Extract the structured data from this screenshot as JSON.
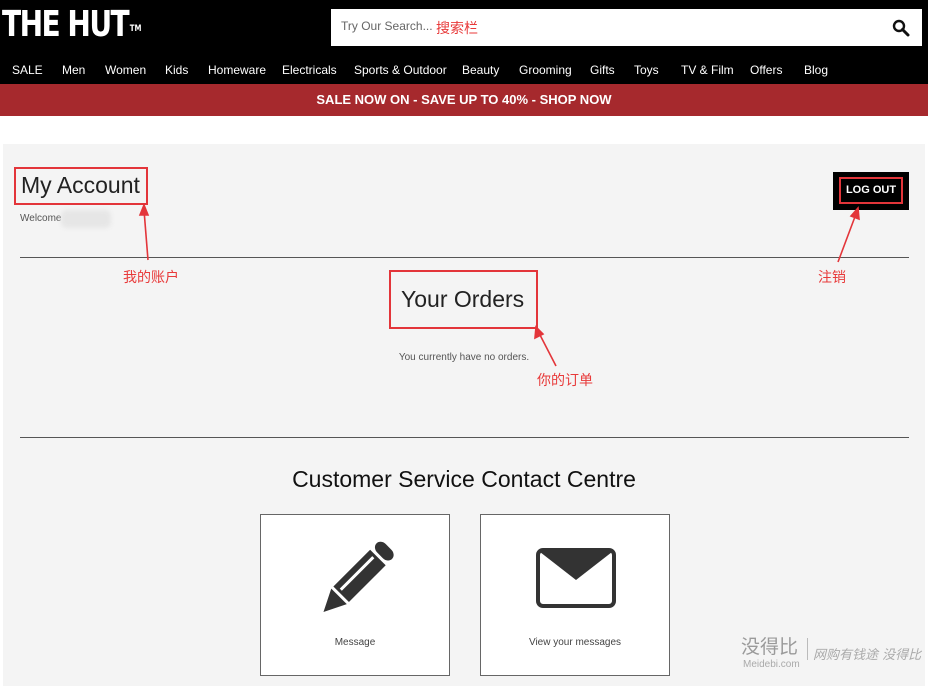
{
  "header": {
    "logo": "THE HUT",
    "logo_tm": "TM",
    "search_placeholder": "Try Our Search...",
    "search_note": "搜索栏",
    "search_icon": "magnifier-icon"
  },
  "nav": {
    "items": [
      "SALE",
      "Men",
      "Women",
      "Kids",
      "Homeware",
      "Electricals",
      "Sports & Outdoor",
      "Beauty",
      "Grooming",
      "Gifts",
      "Toys",
      "TV & Film",
      "Offers",
      "Blog"
    ]
  },
  "promo": {
    "text": "SALE NOW ON - SAVE UP TO 40%  - SHOP NOW"
  },
  "account": {
    "title": "My Account",
    "welcome": "Welcome",
    "logout": "LOG OUT"
  },
  "orders": {
    "title": "Your Orders",
    "empty": "You currently have no orders."
  },
  "notes": {
    "my_account": "我的账户",
    "logout": "注销",
    "orders": "你的订单"
  },
  "contact": {
    "title": "Customer Service Contact Centre",
    "cards": [
      {
        "label": "Message",
        "icon": "pencil-icon"
      },
      {
        "label": "View your messages",
        "icon": "envelope-icon"
      }
    ]
  },
  "watermark": {
    "logo": "没得比",
    "site": "Meidebi.com",
    "tagline": "网购有钱途 没得比"
  },
  "colors": {
    "header_bg": "#000000",
    "promo_bg": "#a6292d",
    "panel_bg": "#f4f4f4",
    "annotation_red": "#e3353a"
  }
}
